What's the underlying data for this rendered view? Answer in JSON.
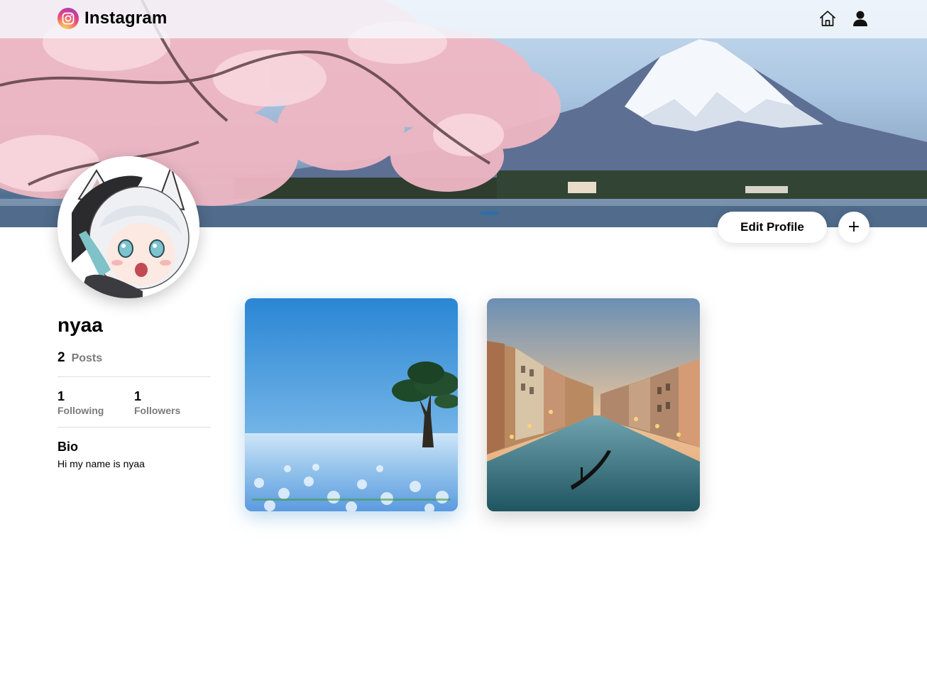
{
  "app": {
    "name": "Instagram",
    "logo_icon": "instagram-logo-icon"
  },
  "nav": {
    "home_icon": "home-icon",
    "profile_icon": "user-icon"
  },
  "cover": {
    "description_icon": "cover-photo"
  },
  "actions": {
    "edit_profile_label": "Edit Profile",
    "add_label": "+"
  },
  "profile": {
    "username": "nyaa",
    "posts_count": "2",
    "posts_label": "Posts",
    "following_count": "1",
    "following_label": "Following",
    "followers_count": "1",
    "followers_label": "Followers",
    "bio_title": "Bio",
    "bio_text": "Hi my name is nyaa"
  },
  "posts": [
    {
      "thumbnail": "flower-field-tree-photo"
    },
    {
      "thumbnail": "canal-city-sunset-photo"
    }
  ],
  "colors": {
    "muted_text": "#7b7b7b",
    "divider": "#dedede",
    "background": "#ffffff"
  }
}
